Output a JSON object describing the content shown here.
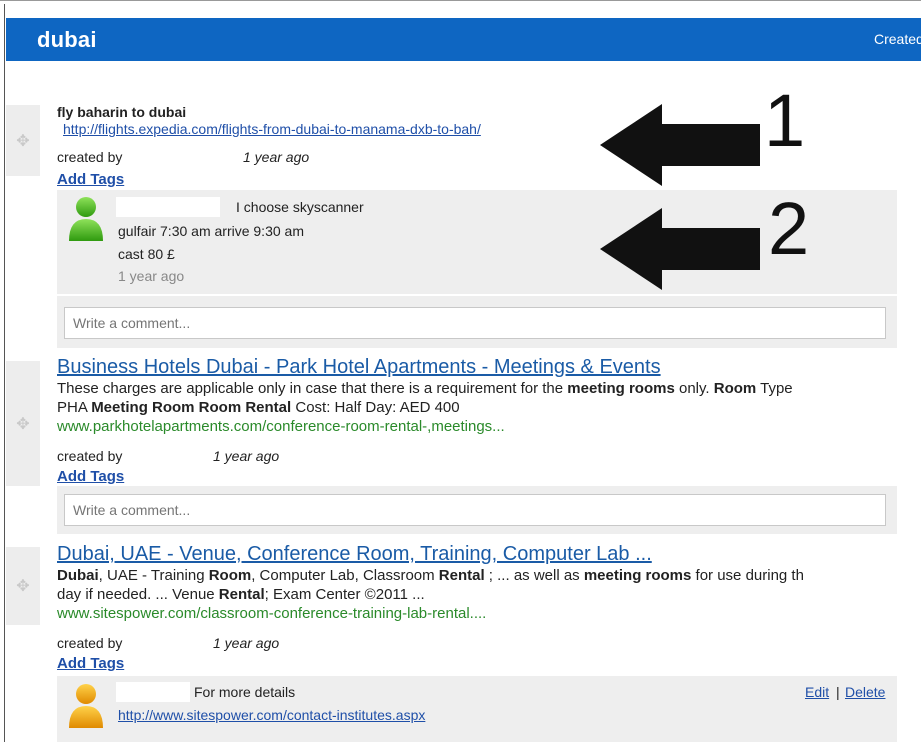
{
  "header": {
    "title": "dubai",
    "created_label": "Created"
  },
  "items": [
    {
      "title": "fly baharin to dubai",
      "url": "http://flights.expedia.com/flights-from-dubai-to-manama-dxb-to-bah/",
      "created_by_label": "created by",
      "ago": "1 year ago",
      "add_tags": "Add Tags",
      "comment": {
        "lines": [
          "I choose skyscanner",
          "gulfair 7:30 am arrive 9:30 am",
          "cast 80 £"
        ],
        "ago": "1 year ago"
      },
      "comment_placeholder": "Write a comment..."
    },
    {
      "title": "Business Hotels Dubai - Park Hotel Apartments - Meetings & Events",
      "desc_line1": [
        {
          "t": "These charges are applicable only in case that there is a requirement for the ",
          "b": false
        },
        {
          "t": "meeting rooms",
          "b": true
        },
        {
          "t": " only. ",
          "b": false
        },
        {
          "t": "Room",
          "b": true
        },
        {
          "t": " Type",
          "b": false
        }
      ],
      "desc_line2": [
        {
          "t": "PHA ",
          "b": false
        },
        {
          "t": "Meeting Room Room Rental",
          "b": true
        },
        {
          "t": " Cost: Half Day: AED 400",
          "b": false
        }
      ],
      "display_url": "www.parkhotelapartments.com/conference-room-rental-,meetings...",
      "created_by_label": "created by",
      "ago": "1 year ago",
      "add_tags": "Add Tags",
      "comment_placeholder": "Write a comment..."
    },
    {
      "title": "Dubai, UAE - Venue, Conference Room, Training, Computer Lab ...",
      "desc_line1": [
        {
          "t": "Dubai",
          "b": true
        },
        {
          "t": ", UAE - Training ",
          "b": false
        },
        {
          "t": "Room",
          "b": true
        },
        {
          "t": ", Computer Lab, Classroom ",
          "b": false
        },
        {
          "t": "Rental",
          "b": true
        },
        {
          "t": " ; ... as well as ",
          "b": false
        },
        {
          "t": "meeting rooms",
          "b": true
        },
        {
          "t": " for use during th",
          "b": false
        }
      ],
      "desc_line2": [
        {
          "t": "day if needed. ... Venue ",
          "b": false
        },
        {
          "t": "Rental",
          "b": true
        },
        {
          "t": "; Exam Center ©2011 ...",
          "b": false
        }
      ],
      "display_url": "www.sitespower.com/classroom-conference-training-lab-rental....",
      "created_by_label": "created by",
      "ago": "1 year ago",
      "add_tags": "Add Tags",
      "comment": {
        "text": "For more details",
        "link": "http://www.sitespower.com/contact-institutes.aspx",
        "edit": "Edit",
        "sep": "|",
        "delete": "Delete"
      }
    }
  ],
  "annotations": {
    "one": "1",
    "two": "2"
  },
  "colors": {
    "header": "#0e66c2",
    "link": "#1f4fa8",
    "green_url": "#2a8a2a",
    "avatar_green": "#4cbb17",
    "avatar_orange": "#f5a300"
  }
}
